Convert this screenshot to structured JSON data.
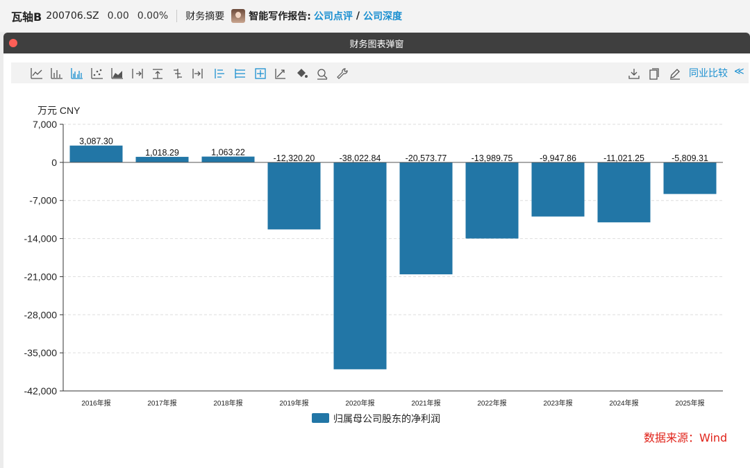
{
  "topbar": {
    "stock_name": "瓦轴B",
    "code": "200706.SZ",
    "price": "0.00",
    "change_pct": "0.00%",
    "financial_summary": "财务摘要",
    "ai_report_label": "智能写作报告:",
    "link_company_review": "公司点评",
    "slash": "/",
    "link_company_depth": "公司深度"
  },
  "window": {
    "title": "财务图表弹窗"
  },
  "toolbar": {
    "left_icons": [
      "line-chart-icon",
      "bar-chart-icon",
      "grouped-bar-icon",
      "scatter-icon",
      "area-chart-icon",
      "axis-right-icon",
      "align-top-icon",
      "align-center-icon",
      "axis-left-icon",
      "list-icon",
      "list-lines-icon",
      "grid-box-icon",
      "trend-icon",
      "fill-bucket-icon",
      "zoom-icon",
      "wrench-icon"
    ],
    "right_icons": [
      "download-icon",
      "copy-icon",
      "edit-icon"
    ],
    "industry_compare": "同业比较",
    "collapse_symbol": "≪"
  },
  "chart_data": {
    "type": "bar",
    "unit_label": "万元  CNY",
    "categories": [
      "2016年报",
      "2017年报",
      "2018年报",
      "2019年报",
      "2020年报",
      "2021年报",
      "2022年报",
      "2023年报",
      "2024年报",
      "2025年报"
    ],
    "series": [
      {
        "name": "归属母公司股东的净利润",
        "values": [
          3087.3,
          1018.29,
          1063.22,
          -12320.2,
          -38022.84,
          -20573.77,
          -13989.75,
          -9947.86,
          -11021.25,
          -5809.31
        ],
        "labels": [
          "3,087.30",
          "1,018.29",
          "1,063.22",
          "-12,320.20",
          "-38,022.84",
          "-20,573.77",
          "-13,989.75",
          "-9,947.86",
          "-11,021.25",
          "-5,809.31"
        ]
      }
    ],
    "yticks": [
      7000,
      0,
      -7000,
      -14000,
      -21000,
      -28000,
      -35000,
      -42000
    ],
    "ytick_labels": [
      "7,000",
      "0",
      "-7,000",
      "-14,000",
      "-21,000",
      "-28,000",
      "-35,000",
      "-42,000"
    ],
    "ylim": [
      -42000,
      7000
    ],
    "grid": true,
    "legend_position": "bottom-center",
    "bar_color": "#2276a6"
  },
  "source_note": "数据来源：Wind"
}
